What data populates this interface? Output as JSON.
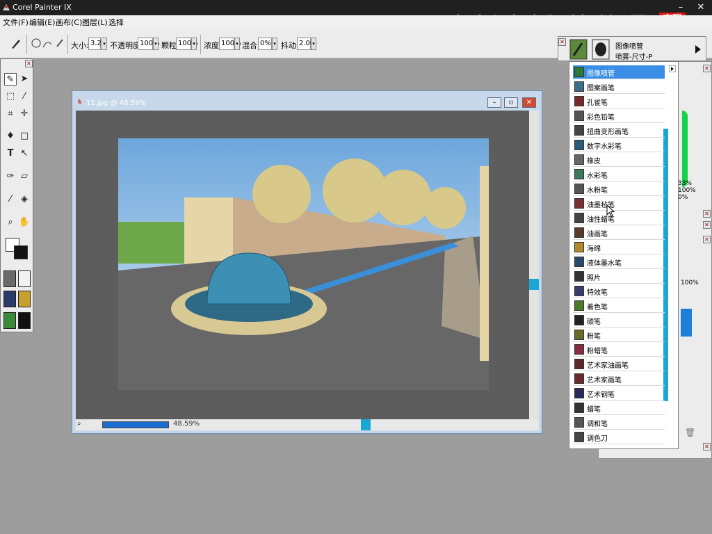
{
  "app": {
    "title": "Corel Painter IX"
  },
  "watermark": {
    "text": "中新金桥 软件通",
    "logo_line1": "育碟",
    "logo_line2": "软件"
  },
  "menu": [
    "文件(F)",
    "编辑(E)",
    "画布(C)",
    "图层(L)",
    "选择"
  ],
  "propbar": {
    "size_label": "大小:",
    "size_value": "3.2",
    "opacity_label": "不透明度:",
    "opacity_value": "100%",
    "grain_label": "颗粒:",
    "grain_value": "100%",
    "density_label": "浓度:",
    "density_value": "100%",
    "blend_label": "混合:",
    "blend_value": "0%",
    "jitter_label": "抖动:",
    "jitter_value": "2.00"
  },
  "document": {
    "title": "11.jpg @ 48.59%",
    "zoom": "48.59%"
  },
  "brush_selector": {
    "category": "图像喷管",
    "variant": "喷雾-尺寸-P"
  },
  "brush_categories": [
    {
      "label": "图像喷管",
      "selected": true,
      "color": "#2c7a3a"
    },
    {
      "label": "图案画笔",
      "selected": false,
      "color": "#3a6e8a"
    },
    {
      "label": "孔雀笔",
      "selected": false,
      "color": "#7a2a2a"
    },
    {
      "label": "彩色铅笔",
      "selected": false,
      "color": "#555555"
    },
    {
      "label": "扭曲变形画笔",
      "selected": false,
      "color": "#444444"
    },
    {
      "label": "数字水彩笔",
      "selected": false,
      "color": "#2a5a7a"
    },
    {
      "label": "橡皮",
      "selected": false,
      "color": "#666666"
    },
    {
      "label": "水彩笔",
      "selected": false,
      "color": "#3a7a5a"
    },
    {
      "label": "水粉笔",
      "selected": false,
      "color": "#555555"
    },
    {
      "label": "油墨毡笔",
      "selected": false,
      "color": "#7a3030"
    },
    {
      "label": "油性蜡笔",
      "selected": false,
      "color": "#444444"
    },
    {
      "label": "油画笔",
      "selected": false,
      "color": "#5a3a2a"
    },
    {
      "label": "海绵",
      "selected": false,
      "color": "#b08a2a"
    },
    {
      "label": "液体墨水笔",
      "selected": false,
      "color": "#2a4a6a"
    },
    {
      "label": "照片",
      "selected": false,
      "color": "#333333"
    },
    {
      "label": "特效笔",
      "selected": false,
      "color": "#3a3a6a"
    },
    {
      "label": "着色笔",
      "selected": false,
      "color": "#4a7a2a"
    },
    {
      "label": "碳笔",
      "selected": false,
      "color": "#222222"
    },
    {
      "label": "粉笔",
      "selected": false,
      "color": "#6a6a2a"
    },
    {
      "label": "粉蜡笔",
      "selected": false,
      "color": "#8a2a3a"
    },
    {
      "label": "艺术家油画笔",
      "selected": false,
      "color": "#5a2a2a"
    },
    {
      "label": "艺术家画笔",
      "selected": false,
      "color": "#6a2a2a"
    },
    {
      "label": "艺术钢笔",
      "selected": false,
      "color": "#2a2a5a"
    },
    {
      "label": "蜡笔",
      "selected": false,
      "color": "#333333"
    },
    {
      "label": "调和笔",
      "selected": false,
      "color": "#555555"
    },
    {
      "label": "调色刀",
      "selected": false,
      "color": "#444444"
    }
  ],
  "right_panel": {
    "pct1": "33%",
    "pct2": "100%",
    "pct3": "0%",
    "pct4": "100%"
  },
  "colors": {
    "title_bg": "#202020",
    "selection": "#3a8ee6",
    "scroll_accent": "#1ba7d6"
  }
}
